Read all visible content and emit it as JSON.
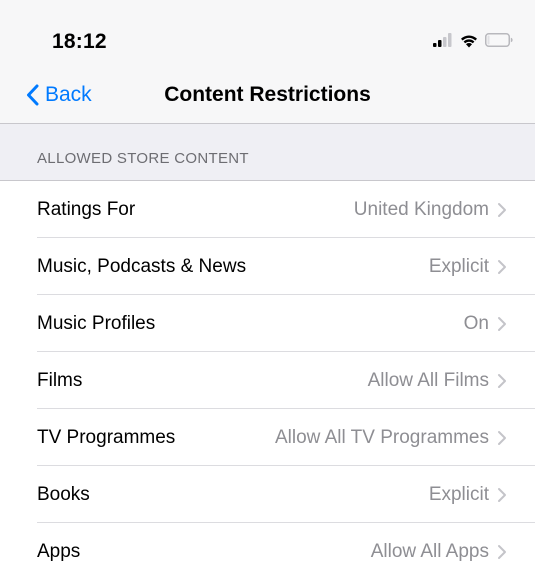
{
  "status": {
    "time": "18:12"
  },
  "nav": {
    "back_label": "Back",
    "title": "Content Restrictions"
  },
  "section": {
    "header": "ALLOWED STORE CONTENT"
  },
  "rows": [
    {
      "label": "Ratings For",
      "value": "United Kingdom"
    },
    {
      "label": "Music, Podcasts & News",
      "value": "Explicit"
    },
    {
      "label": "Music Profiles",
      "value": "On"
    },
    {
      "label": "Films",
      "value": "Allow All Films"
    },
    {
      "label": "TV Programmes",
      "value": "Allow All TV Programmes"
    },
    {
      "label": "Books",
      "value": "Explicit"
    },
    {
      "label": "Apps",
      "value": "Allow All Apps"
    }
  ],
  "colors": {
    "accent": "#007aff",
    "secondary_text": "#8e8e93",
    "group_background": "#efeff4"
  },
  "icons": [
    "cellular-signal-icon",
    "wifi-icon",
    "battery-icon",
    "chevron-left-icon",
    "chevron-right-icon"
  ]
}
